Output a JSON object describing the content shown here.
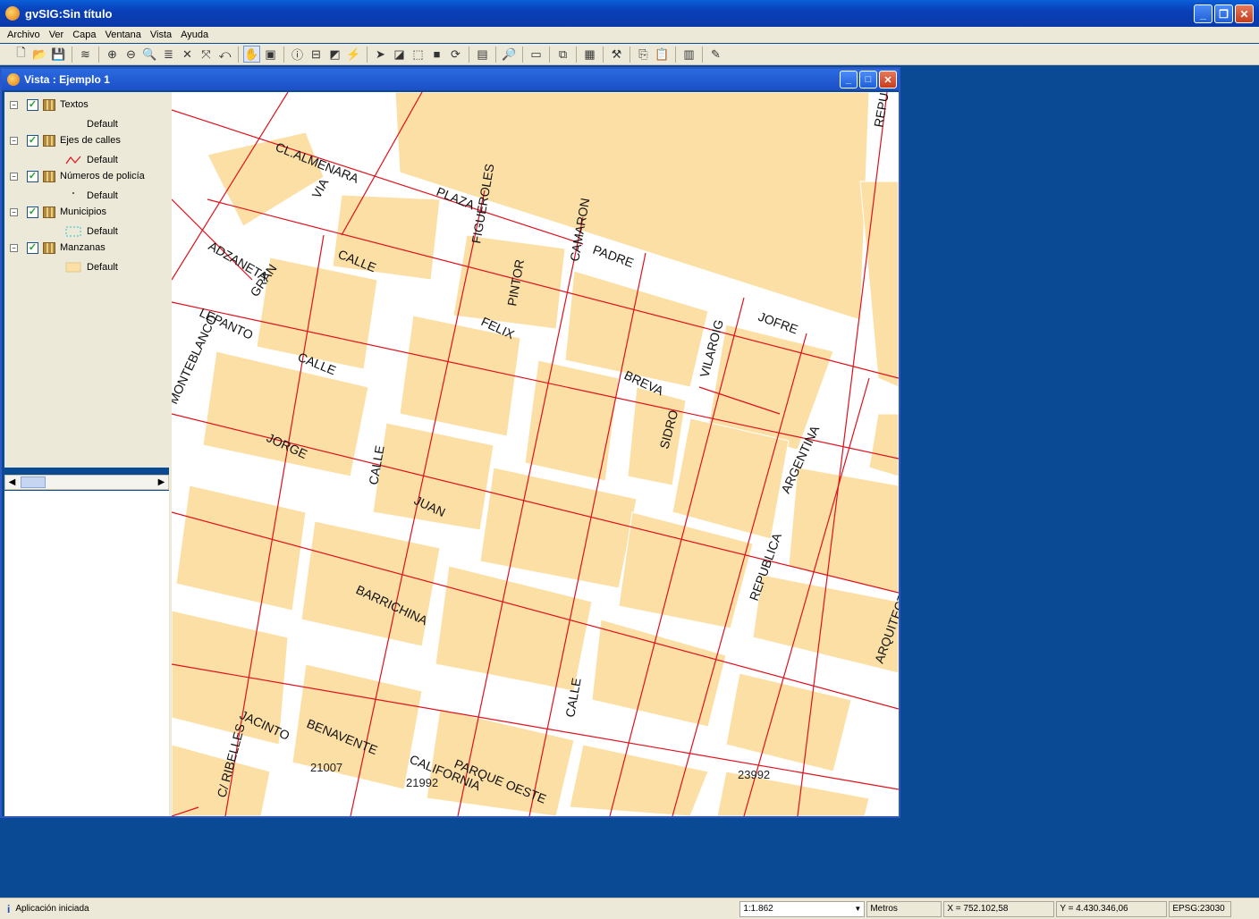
{
  "app": {
    "title": "gvSIG:Sin título"
  },
  "menu": [
    "Archivo",
    "Ver",
    "Capa",
    "Ventana",
    "Vista",
    "Ayuda"
  ],
  "view": {
    "title": "Vista : Ejemplo 1",
    "layers": [
      {
        "name": "Textos",
        "legend": "Default",
        "symbol": "none"
      },
      {
        "name": "Ejes de calles",
        "legend": "Default",
        "symbol": "red-line"
      },
      {
        "name": "Números de policía",
        "legend": "Default",
        "symbol": "dot"
      },
      {
        "name": "Municipios",
        "legend": "Default",
        "symbol": "cyan-dashed-box"
      },
      {
        "name": "Manzanas",
        "legend": "Default",
        "symbol": "tan-box"
      }
    ]
  },
  "map": {
    "street_labels": [
      "CL.ALMENARA",
      "VIA",
      "PLAZA",
      "FIGUEROLES",
      "CALLE",
      "ADZANETA",
      "GRAN",
      "CAMARON",
      "PINTOR",
      "PADRE",
      "JOFRE",
      "LEPANTO",
      "FELIX",
      "CALLE",
      "VILAROIG",
      "MONTEBLANCO",
      "BREVA",
      "SIDRO",
      "ARGENTINA",
      "JORGE",
      "JUAN",
      "CALLE",
      "REPUBLICA",
      "BARRICHINA",
      "JACINTO",
      "C/ RIBELLES",
      "BENAVENTE",
      "CALIFORNIA",
      "PARQUE OESTE",
      "ARQUITECTO",
      "CALLE",
      "REPU"
    ],
    "municipality_codes": [
      "21007",
      "21992",
      "23992"
    ]
  },
  "status": {
    "message": "Aplicación iniciada",
    "scale": "1:1.862",
    "units": "Metros",
    "x": "X = 752.102,58",
    "y": "Y = 4.430.346,06",
    "crs": "EPSG:23030"
  },
  "colors": {
    "desktop": "#0a4a94",
    "block": "#fbdfa4",
    "street_axis": "#e0101c"
  }
}
